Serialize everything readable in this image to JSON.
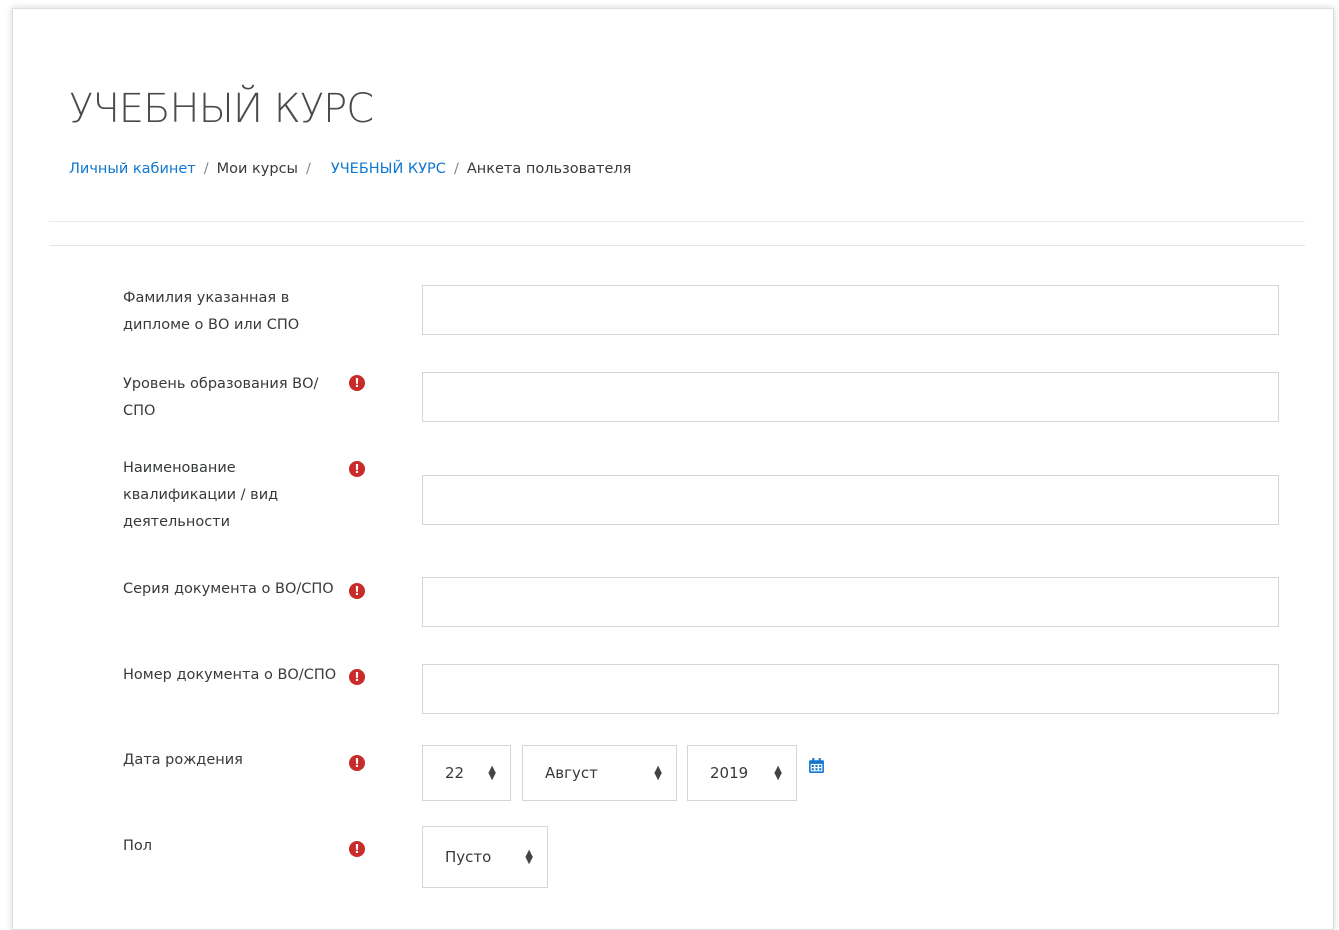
{
  "page": {
    "title": "УЧЕБНЫЙ КУРС"
  },
  "breadcrumb": [
    {
      "label": "Личный кабинет",
      "link": true
    },
    {
      "label": "Мои курсы",
      "link": false
    },
    {
      "label": "УЧЕБНЫЙ КУРС",
      "link": true
    },
    {
      "label": "Анкета пользователя",
      "link": false
    }
  ],
  "breadcrumb_separator": "/",
  "form": {
    "fields": [
      {
        "label": "Фамилия указанная в дипломе о ВО или СПО",
        "required": false,
        "value": ""
      },
      {
        "label": "Уровень образования ВО/СПО",
        "required": true,
        "value": ""
      },
      {
        "label": "Наименование квалификации / вид деятельности",
        "required": true,
        "value": ""
      },
      {
        "label": "Серия документа о ВО/СПО",
        "required": true,
        "value": ""
      },
      {
        "label": "Номер документа о ВО/СПО",
        "required": true,
        "value": ""
      }
    ],
    "birth_date": {
      "label": "Дата рождения",
      "required": true,
      "day": "22",
      "month": "Август",
      "year": "2019"
    },
    "gender": {
      "label": "Пол",
      "required": true,
      "value": "Пусто"
    }
  },
  "icons": {
    "required": "exclamation-circle-icon",
    "calendar": "calendar-icon",
    "select_arrows": "sort-arrows-icon"
  },
  "colors": {
    "link": "#1177d1",
    "required": "#c92a2a",
    "border": "#d5d5d5"
  }
}
